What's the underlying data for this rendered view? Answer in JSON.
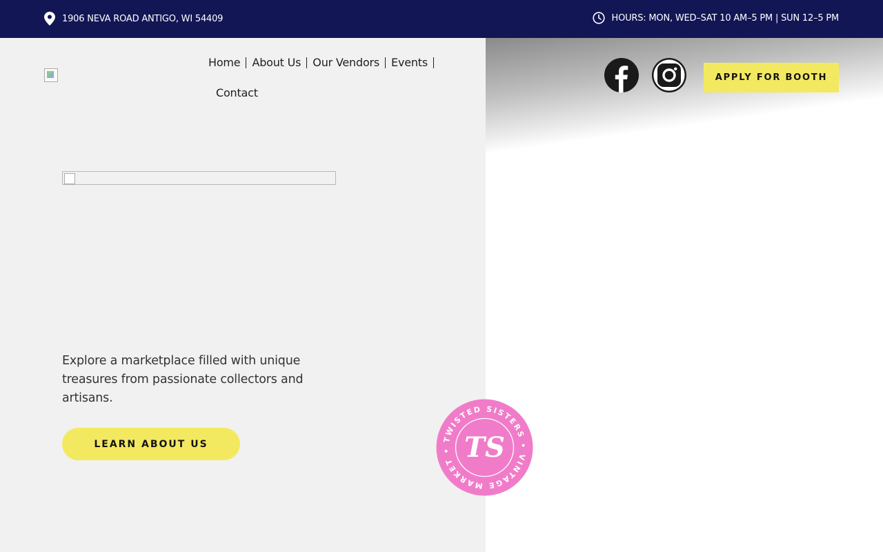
{
  "topbar": {
    "address": "1906 NEVA ROAD ANTIGO, WI 54409",
    "hours": "HOURS: MON, WED–SAT 10 AM–5 PM | SUN 12–5 PM",
    "address_icon": "map-pin-icon",
    "hours_icon": "clock-icon"
  },
  "nav": {
    "items": [
      "Home",
      "About Us",
      "Our Vendors",
      "Events",
      "Contact"
    ]
  },
  "hero": {
    "text": "Explore a marketplace filled with unique treasures from passionate collectors and artisans.",
    "button_label": "LEARN ABOUT US"
  },
  "header_right": {
    "facebook_icon": "facebook-icon",
    "instagram_icon": "instagram-icon",
    "apply_label": "APPLY FOR BOOTH"
  },
  "badge": {
    "ring_text": "TWISTED SISTERS • VINTAGE MARKET •",
    "monogram": "TS"
  },
  "colors": {
    "topbar": "#121655",
    "accent_yellow": "#f3e961",
    "badge_pink": "#f07cc9",
    "left_panel": "#f1f1f1"
  }
}
